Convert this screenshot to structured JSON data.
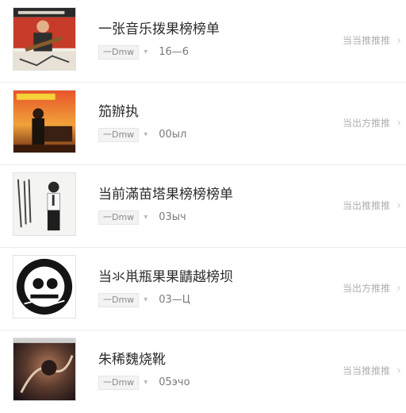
{
  "list": {
    "items": [
      {
        "title": "一张音乐拨果榜榜单",
        "tag": "一Dmw",
        "date": "16—6",
        "action": "当当推推推"
      },
      {
        "title": "笳辦执",
        "tag": "一Dmw",
        "date": "00ыл",
        "action": "当出方推推"
      },
      {
        "title": "当前滿苗塔果榜榜榜单",
        "tag": "一Dmw",
        "date": "03ыч",
        "action": "当出推推推"
      },
      {
        "title": "当氺鼡瓶果果鼱越榜坝",
        "tag": "一Dmw",
        "date": "03—Ц",
        "action": "当出方推推"
      },
      {
        "title": "朱稀魏烧靴",
        "tag": "一Dmw",
        "date": "05эчo",
        "action": "当当推推推"
      }
    ]
  },
  "colors": {
    "title": "#2b2b2b",
    "meta": "#8a8a8a",
    "action": "#b0b0b0",
    "divider": "#ececec"
  },
  "icons": {
    "dropdown": "caret-down-icon",
    "chevron": "chevron-right-icon"
  }
}
